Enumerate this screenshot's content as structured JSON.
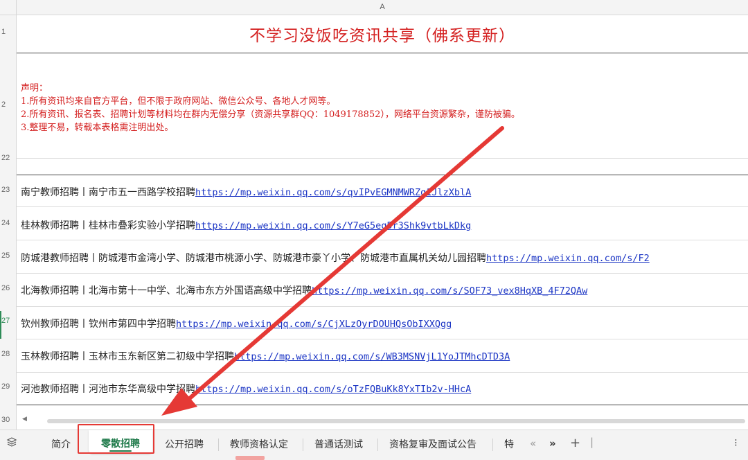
{
  "sheet": {
    "column_label": "A",
    "row_numbers": [
      "1",
      "2",
      "22",
      "23",
      "24",
      "25",
      "26",
      "27",
      "28",
      "29",
      "30"
    ],
    "title": "不学习没饭吃资讯共享（佛系更新）",
    "declaration": {
      "heading": "声明：",
      "lines": [
        "1.所有资讯均来自官方平台，但不限于政府网站、微信公众号、各地人才网等。",
        "2.所有资讯、报名表、招聘计划等材料均在群内无偿分享（资源共享群QQ：1049178852），网络平台资源繁杂，谨防被骗。",
        "3.整理不易，转载本表格需注明出处。"
      ]
    },
    "rows": [
      {
        "text": "南宁教师招聘丨南宁市五一西路学校招聘",
        "link": "https://mp.weixin.qq.com/s/qvIPvEGMNMWRZg1JlzXblA"
      },
      {
        "text": "桂林教师招聘丨桂林市叠彩实验小学招聘",
        "link": "https://mp.weixin.qq.com/s/Y7eG5eq5r3Shk9vtbLkDkg"
      },
      {
        "text": "防城港教师招聘丨防城港市金湾小学、防城港市桃源小学、防城港市豪丫小学、防城港市直属机关幼儿园招聘",
        "link": "https://mp.weixin.qq.com/s/F2"
      },
      {
        "text": "北海教师招聘丨北海市第十一中学、北海市东方外国语高级中学招聘",
        "link": "https://mp.weixin.qq.com/s/SOF73_vex8HqXB_4F72QAw"
      },
      {
        "text": "钦州教师招聘丨钦州市第四中学招聘",
        "link": "https://mp.weixin.qq.com/s/CjXLzOyrDOUHQsObIXXQgg"
      },
      {
        "text": "玉林教师招聘丨玉林市玉东新区第二初级中学招聘",
        "link": "https://mp.weixin.qq.com/s/WB3MSNVjL1YoJTMhcDTD3A"
      },
      {
        "text": "河池教师招聘丨河池市东华高级中学招聘",
        "link": "https://mp.weixin.qq.com/s/oTzFQBuKk8YxTIb2v-HHcA"
      }
    ]
  },
  "tabs": {
    "items": [
      "简介",
      "零散招聘",
      "公开招聘",
      "教师资格认定",
      "普通话测试",
      "资格复审及面试公告",
      "特"
    ],
    "active_index": 1
  },
  "colors": {
    "title_red": "#d42020",
    "link_blue": "#1a34c4",
    "active_tab_green": "#1f7a4a",
    "annotation_red": "#e53935"
  }
}
